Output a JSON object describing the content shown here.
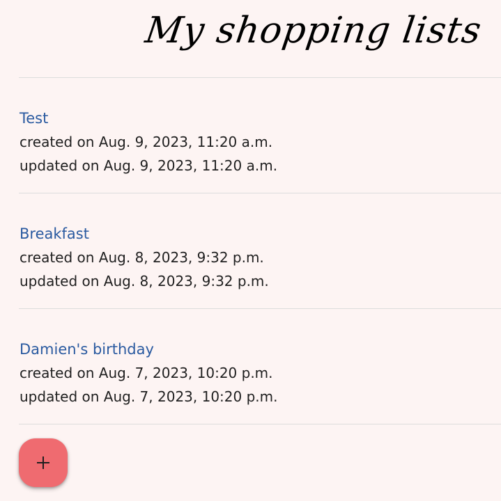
{
  "header": {
    "title": "My shopping lists"
  },
  "lists": [
    {
      "name": "Test",
      "created": "created on Aug. 9, 2023, 11:20 a.m.",
      "updated": "updated on Aug. 9, 2023, 11:20 a.m."
    },
    {
      "name": "Breakfast",
      "created": "created on Aug. 8, 2023, 9:32 p.m.",
      "updated": "updated on Aug. 8, 2023, 9:32 p.m."
    },
    {
      "name": "Damien's birthday",
      "created": "created on Aug. 7, 2023, 10:20 p.m.",
      "updated": "updated on Aug. 7, 2023, 10:20 p.m."
    }
  ],
  "fab": {
    "icon": "plus-icon",
    "color": "#ef6b70"
  },
  "colors": {
    "background": "#fdf4f3",
    "link": "#2a5aa0",
    "divider": "#dcdcdc"
  }
}
